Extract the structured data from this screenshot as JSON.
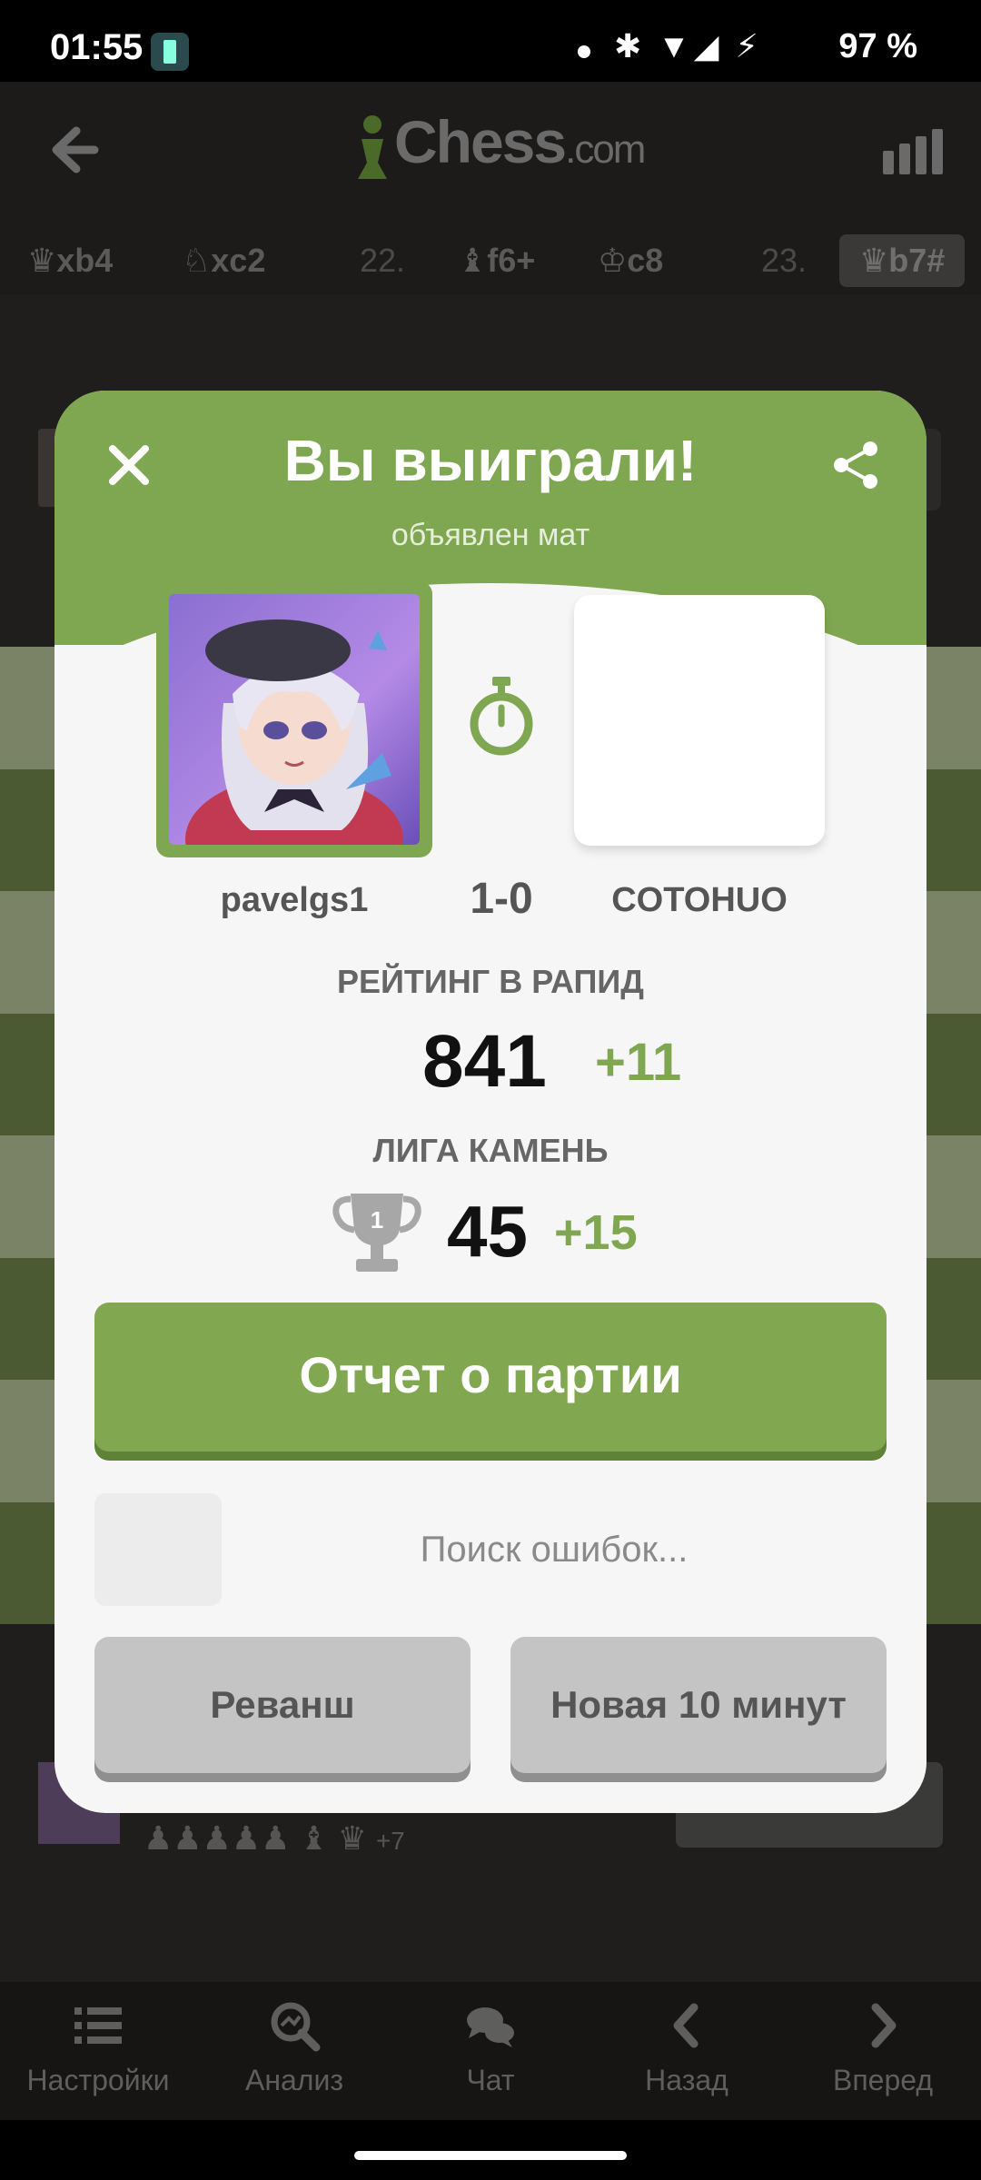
{
  "status": {
    "time": "01:55",
    "battery": "97 %",
    "icons": "✱ ▼◢ ⚡"
  },
  "header": {
    "logo_main": "Chess",
    "logo_suffix": ".com"
  },
  "moves": [
    {
      "text": "♛xb4"
    },
    {
      "text": "♘xc2"
    },
    {
      "text": "22."
    },
    {
      "text": "♝f6+"
    },
    {
      "text": "♔c8"
    },
    {
      "text": "23."
    },
    {
      "text": "♛b7#"
    }
  ],
  "captured": {
    "pieces": "♟♟♟♟♟ ♝ ♛",
    "plus": "+7"
  },
  "modal": {
    "title": "Вы выиграли!",
    "subtitle": "объявлен мат",
    "player_left": "pavelgs1",
    "score": "1-0",
    "player_right": "COTOHUO",
    "rating_label": "РЕЙТИНГ В РАПИД",
    "rating_value": "841",
    "rating_delta": "+11",
    "league_label": "ЛИГА КАМЕНЬ",
    "trophy_number": "1",
    "league_value": "45",
    "league_delta": "+15",
    "report_button": "Отчет о партии",
    "loading_text": "Поиск ошибок...",
    "rematch_button": "Реванш",
    "new_game_button": "Новая 10 минут"
  },
  "nav": [
    {
      "label": "Настройки",
      "icon": "list-icon"
    },
    {
      "label": "Анализ",
      "icon": "analysis-icon"
    },
    {
      "label": "Чат",
      "icon": "chat-icon"
    },
    {
      "label": "Назад",
      "icon": "chevron-left-icon"
    },
    {
      "label": "Вперед",
      "icon": "chevron-right-icon"
    }
  ],
  "colors": {
    "accent_green": "#7fa650",
    "modal_bg": "#f6f6f6",
    "button_grey": "#c4c4c4"
  }
}
